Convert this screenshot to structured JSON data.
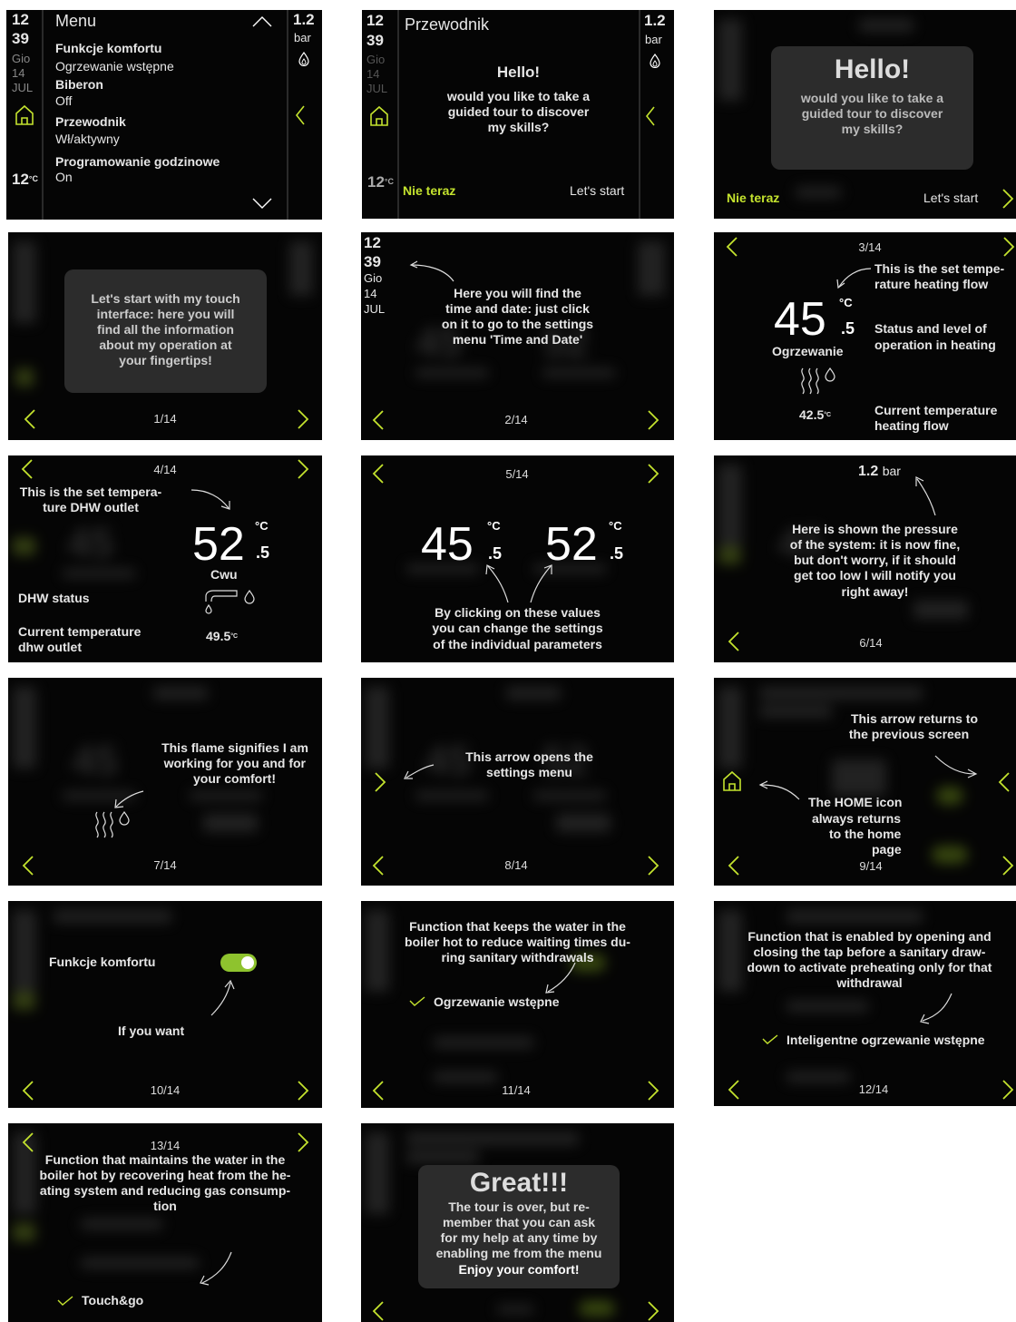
{
  "colors": {
    "accent": "#c4e32e",
    "toggle_on": "#8ec32e",
    "screen_bg": "#050505",
    "card_bg": "#2c2c2c"
  },
  "s1": {
    "time_h": "12",
    "time_m": "39",
    "day": "Gio",
    "date": "14",
    "month": "JUL",
    "temp": "12",
    "temp_unit": "°C",
    "title": "Menu",
    "items": [
      {
        "label": "Funkcje komfortu",
        "value": "Ogrzewanie wstępne"
      },
      {
        "label": "Biberon",
        "value": "Off"
      },
      {
        "label": "Przewodnik",
        "value": "Wł/aktywny"
      },
      {
        "label": "Programowanie godzinowe",
        "value": "On"
      }
    ],
    "pressure": "1.2",
    "pressure_unit": "bar"
  },
  "s2": {
    "time_h": "12",
    "time_m": "39",
    "day": "Gio",
    "date": "14",
    "month": "JUL",
    "temp": "12",
    "temp_unit": "°C",
    "title": "Przewodnik",
    "pressure": "1.2",
    "pressure_unit": "bar",
    "hello": "Hello!",
    "line1": "would you like to take a",
    "line2": "guided tour to discover",
    "line3": "my skills?",
    "not_now": "Nie teraz",
    "start": "Let's start"
  },
  "s3": {
    "hello": "Hello!",
    "line1": "would you like to take a",
    "line2": "guided tour to discover",
    "line3": "my skills?",
    "not_now": "Nie teraz",
    "start": "Let's start"
  },
  "s4": {
    "l1": "Let's start with my touch",
    "l2": "interface: here you will",
    "l3": "find all the information",
    "l4": "about my operation at",
    "l5": "your fingertips!",
    "page": "1/14"
  },
  "s5": {
    "time_h": "12",
    "time_m": "39",
    "day": "Gio",
    "date": "14",
    "month": "JUL",
    "l1": "Here you will find the",
    "l2": "time and date: just click",
    "l3": "on it to go to the settings",
    "l4": "menu 'Time and Date'",
    "page": "2/14"
  },
  "s6": {
    "page": "3/14",
    "setpoint": "45",
    "half": ".5",
    "unit": "°C",
    "label": "Ogrzewanie",
    "current": "42.5",
    "current_unit": "°C",
    "n1a": "This is the set tempe-",
    "n1b": "rature heating flow",
    "n2a": "Status and level of",
    "n2b": "operation in heating",
    "n3a": "Current temperature",
    "n3b": "heating flow"
  },
  "s7": {
    "page": "4/14",
    "n1a": "This is the set tempera-",
    "n1b": "ture DHW outlet",
    "setpoint": "52",
    "half": ".5",
    "unit": "°C",
    "label": "Cwu",
    "status": "DHW status",
    "cur_a": "Current temperature",
    "cur_b": "dhw outlet",
    "current": "49.5",
    "current_unit": "°C"
  },
  "s8": {
    "page": "5/14",
    "v1": "45",
    "v2": "52",
    "half": ".5",
    "unit": "°C",
    "l1": "By clicking on these values",
    "l2": "you can change the settings",
    "l3": "of the individual parameters"
  },
  "s9": {
    "pressure": "1.2",
    "pressure_unit": "bar",
    "l1": "Here is shown the pressure",
    "l2": "of the system: it is now fine,",
    "l3": "but don't worry, if it should",
    "l4": "get too low I will notify you",
    "l5": "right away!",
    "page": "6/14"
  },
  "s10": {
    "l1": "This flame signifies I am",
    "l2": "working for you and for",
    "l3": "your comfort!",
    "page": "7/14"
  },
  "s11": {
    "l1": "This arrow opens the",
    "l2": "settings menu",
    "page": "8/14"
  },
  "s12": {
    "r1": "This arrow returns to",
    "r2": "the previous screen",
    "h1": "The HOME icon",
    "h2": "always returns",
    "h3": "to the home",
    "h4": "page",
    "page": "9/14"
  },
  "s13": {
    "label": "Funkcje komfortu",
    "hint": "If you want",
    "page": "10/14"
  },
  "s14": {
    "l1": "Function that keeps the water in the",
    "l2": "boiler hot to reduce waiting times du-",
    "l3": "ring sanitary withdrawals",
    "check": "Ogrzewanie wstępne",
    "page": "11/14"
  },
  "s15": {
    "l1": "Function that is enabled by opening and",
    "l2": "closing the tap before a sanitary draw-",
    "l3": "down to activate preheating only for that",
    "l4": "withdrawal",
    "check": "Inteligentne ogrzewanie wstępne",
    "page": "12/14"
  },
  "s16": {
    "page": "13/14",
    "l1": "Function that maintains the water in the",
    "l2": "boiler hot by recovering heat from the he-",
    "l3": "ating system and reducing gas consump-",
    "l4": "tion",
    "check": "Touch&go"
  },
  "s17": {
    "title": "Great!!!",
    "l1": "The tour is over, but re-",
    "l2": "member that you can ask",
    "l3": "for my help at any time by",
    "l4": "enabling me from the menu",
    "l5": "Enjoy your comfort!"
  }
}
